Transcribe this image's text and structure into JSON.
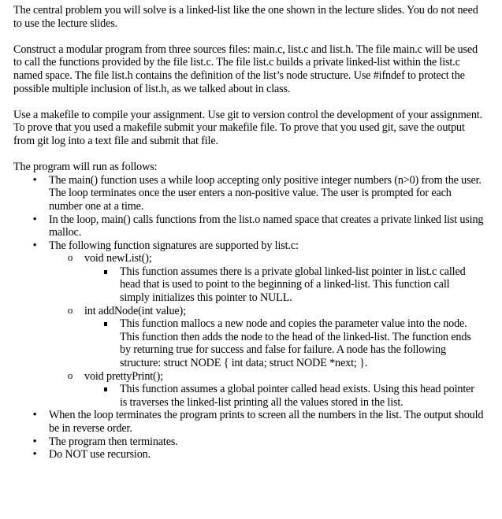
{
  "document": {
    "paragraphs": [
      "The central problem you will solve is a linked-list like the one shown in the lecture slides. You do not need to use the lecture slides.",
      "Construct a modular program from three sources files: main.c, list.c and list.h.  The file main.c will be used to call the functions provided by the file list.c.  The file list.c builds a private linked-list within the list.c named space.  The file list.h contains the definition of the list’s node structure. Use #ifndef to protect the possible multiple inclusion of list.h, as we talked about in class.",
      "Use a makefile to compile your assignment. Use git to version control the development of your assignment. To prove that you used a makefile submit your makefile file. To prove that you used git, save the output from git log into a text file and submit that file."
    ],
    "intro": "The program will run as follows:",
    "markers": {
      "level1": "•",
      "level2": "o"
    },
    "bullets": [
      {
        "text": "The main() function uses a while loop accepting only positive integer numbers (n>0) from the user. The loop terminates once the user enters a non-positive value. The user is prompted for each number one at a time."
      },
      {
        "text": "In the loop, main() calls functions from the list.o named space that creates a private linked list using malloc."
      },
      {
        "text": "The following function signatures are supported by list.c:",
        "functions": [
          {
            "signature": "void newList();",
            "description": "This function assumes there is a private global linked-list pointer in list.c called head that is used to point to the beginning of a linked-list. This function call simply initializes this pointer to NULL."
          },
          {
            "signature": "int addNode(int value);",
            "description": "This function mallocs a new node and copies the parameter value into the node.  This function then adds the node to the head of the linked-list.  The function ends by returning true for success and false for failure. A node has the following structure: struct NODE { int data; struct NODE *next; }."
          },
          {
            "signature": "void prettyPrint();",
            "description": "This function assumes a global pointer called head exists.  Using this head pointer is traverses the linked-list printing all the values stored in the list."
          }
        ]
      },
      {
        "text": "When the loop terminates the program prints to screen all the numbers in the list. The output should be in reverse order."
      },
      {
        "text": "The program then terminates."
      },
      {
        "text": "Do NOT use recursion."
      }
    ]
  }
}
